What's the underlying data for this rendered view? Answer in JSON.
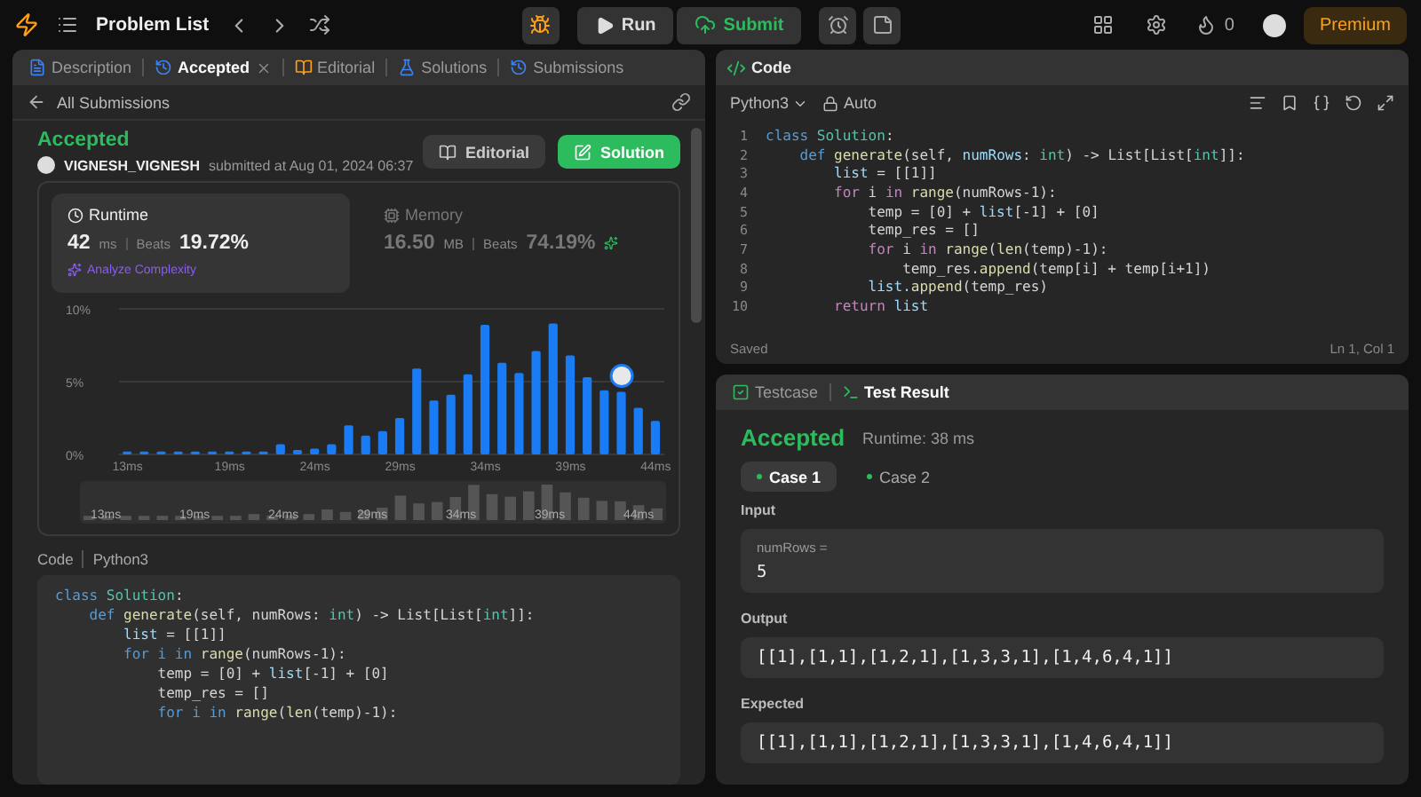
{
  "topbar": {
    "title": "Problem List",
    "run": "Run",
    "submit": "Submit",
    "streak": "0",
    "premium": "Premium"
  },
  "left": {
    "tabs": [
      {
        "label": "Description",
        "selected": false,
        "closable": false
      },
      {
        "label": "Accepted",
        "selected": true,
        "closable": true
      },
      {
        "label": "Editorial",
        "selected": false,
        "closable": false
      },
      {
        "label": "Solutions",
        "selected": false,
        "closable": false
      },
      {
        "label": "Submissions",
        "selected": false,
        "closable": false
      }
    ],
    "back": "All Submissions",
    "status": "Accepted",
    "user": "VIGNESH_VIGNESH",
    "submitted": "submitted at Aug 01, 2024 06:37",
    "buttons": [
      {
        "label": "Editorial",
        "kind": "secondary"
      },
      {
        "label": "Solution",
        "kind": "primary"
      }
    ],
    "metrics": [
      {
        "label": "Runtime",
        "value": "42",
        "unit": "ms",
        "beats_label": "Beats",
        "beats": "19.72%",
        "selected": true,
        "extra": "Analyze Complexity"
      },
      {
        "label": "Memory",
        "value": "16.50",
        "unit": "MB",
        "beats_label": "Beats",
        "beats": "74.19%",
        "selected": false
      }
    ],
    "chart_data": {
      "type": "bar",
      "x": [
        13,
        14,
        15,
        16,
        17,
        18,
        19,
        20,
        21,
        22,
        23,
        24,
        25,
        26,
        27,
        28,
        29,
        30,
        31,
        32,
        33,
        34,
        35,
        36,
        37,
        38,
        39,
        40,
        41,
        42,
        43,
        44
      ],
      "values": [
        0.2,
        0.2,
        0.2,
        0.2,
        0.2,
        0.2,
        0.2,
        0.2,
        0.2,
        0.7,
        0.3,
        0.4,
        0.7,
        2.0,
        1.3,
        1.6,
        2.5,
        5.9,
        3.7,
        4.1,
        5.5,
        8.9,
        6.3,
        5.6,
        7.1,
        9.0,
        6.8,
        5.3,
        4.4,
        4.3,
        3.2,
        2.3
      ],
      "xlim": [
        12.5,
        44.5
      ],
      "xticks": [
        {
          "value": 13,
          "label": "13ms"
        },
        {
          "value": 19,
          "label": "19ms"
        },
        {
          "value": 24,
          "label": "24ms"
        },
        {
          "value": 29,
          "label": "29ms"
        },
        {
          "value": 34,
          "label": "34ms"
        },
        {
          "value": 39,
          "label": "39ms"
        },
        {
          "value": 44,
          "label": "44ms"
        }
      ],
      "yticks": [
        {
          "value": 0,
          "label": "0%"
        },
        {
          "value": 5,
          "label": "5%"
        },
        {
          "value": 10,
          "label": "10%"
        }
      ],
      "ylim": [
        0,
        10
      ]
    },
    "overview_ticks": [
      "13ms",
      "19ms",
      "24ms",
      "29ms",
      "34ms",
      "39ms",
      "44ms"
    ],
    "code_label": "Code",
    "code_lang": "Python3",
    "code": [
      [
        {
          "text": "class",
          "kind": "kw"
        },
        {
          "text": " Solution",
          "kind": "cls"
        },
        {
          "text": ":",
          "kind": "plain"
        }
      ],
      [
        {
          "text": "    def",
          "kind": "kw"
        },
        {
          "text": " generate",
          "kind": "fn"
        },
        {
          "text": "(self, numRows: ",
          "kind": "plain"
        },
        {
          "text": "int",
          "kind": "type"
        },
        {
          "text": ") -> List[List[",
          "kind": "plain"
        },
        {
          "text": "int",
          "kind": "type"
        },
        {
          "text": "]]:",
          "kind": "plain"
        }
      ],
      [
        {
          "text": "        list",
          "kind": "var"
        },
        {
          "text": " = [[1]]",
          "kind": "plain"
        }
      ],
      [
        {
          "text": "        for i in",
          "kind": "kw"
        },
        {
          "text": " range",
          "kind": "fn"
        },
        {
          "text": "(numRows-1):",
          "kind": "plain"
        }
      ],
      [
        {
          "text": "            temp = [0] + ",
          "kind": "plain"
        },
        {
          "text": "list",
          "kind": "var"
        },
        {
          "text": "[-1] + [0]",
          "kind": "plain"
        }
      ],
      [
        {
          "text": "            temp_res = []",
          "kind": "plain"
        }
      ],
      [
        {
          "text": "            for i in",
          "kind": "kw"
        },
        {
          "text": " range",
          "kind": "fn"
        },
        {
          "text": "(",
          "kind": "plain"
        },
        {
          "text": "len",
          "kind": "fn"
        },
        {
          "text": "(temp)-1):",
          "kind": "plain"
        }
      ]
    ]
  },
  "editor": {
    "title": "Code",
    "language": "Python3",
    "mode": "Auto",
    "saved": "Saved",
    "position": "Ln 1, Col 1",
    "lines": [
      {
        "n": "1",
        "tokens": [
          {
            "text": "class",
            "kind": "kw"
          },
          {
            "text": " Solution",
            "kind": "cls"
          },
          {
            "text": ":",
            "kind": "plain"
          }
        ]
      },
      {
        "n": "2",
        "tokens": [
          {
            "text": "    def",
            "kind": "kw"
          },
          {
            "text": " generate",
            "kind": "fn"
          },
          {
            "text": "(self, ",
            "kind": "plain"
          },
          {
            "text": "numRows",
            "kind": "var"
          },
          {
            "text": ": ",
            "kind": "plain"
          },
          {
            "text": "int",
            "kind": "type"
          },
          {
            "text": ") -> List[List[",
            "kind": "plain"
          },
          {
            "text": "int",
            "kind": "type"
          },
          {
            "text": "]]:",
            "kind": "plain"
          }
        ]
      },
      {
        "n": "3",
        "tokens": [
          {
            "text": "        list",
            "kind": "var"
          },
          {
            "text": " = [[1]]",
            "kind": "plain"
          }
        ]
      },
      {
        "n": "4",
        "tokens": [
          {
            "text": "        for",
            "kind": "ctl"
          },
          {
            "text": " i ",
            "kind": "plain"
          },
          {
            "text": "in",
            "kind": "ctl"
          },
          {
            "text": " range",
            "kind": "fn"
          },
          {
            "text": "(numRows-1):",
            "kind": "plain"
          }
        ]
      },
      {
        "n": "5",
        "tokens": [
          {
            "text": "            temp = [0] + ",
            "kind": "plain"
          },
          {
            "text": "list",
            "kind": "var"
          },
          {
            "text": "[-1] + [0]",
            "kind": "plain"
          }
        ]
      },
      {
        "n": "6",
        "tokens": [
          {
            "text": "            temp_res = []",
            "kind": "plain"
          }
        ]
      },
      {
        "n": "7",
        "tokens": [
          {
            "text": "            for",
            "kind": "ctl"
          },
          {
            "text": " i ",
            "kind": "plain"
          },
          {
            "text": "in",
            "kind": "ctl"
          },
          {
            "text": " range",
            "kind": "fn"
          },
          {
            "text": "(",
            "kind": "plain"
          },
          {
            "text": "len",
            "kind": "fn"
          },
          {
            "text": "(temp)-1):",
            "kind": "plain"
          }
        ]
      },
      {
        "n": "8",
        "tokens": [
          {
            "text": "                temp_res.",
            "kind": "plain"
          },
          {
            "text": "append",
            "kind": "fn"
          },
          {
            "text": "(temp[i] + temp[i+1])",
            "kind": "plain"
          }
        ]
      },
      {
        "n": "9",
        "tokens": [
          {
            "text": "            list.",
            "kind": "var"
          },
          {
            "text": "append",
            "kind": "fn"
          },
          {
            "text": "(temp_res)",
            "kind": "plain"
          }
        ]
      },
      {
        "n": "10",
        "tokens": [
          {
            "text": "        return",
            "kind": "ctl"
          },
          {
            "text": " list",
            "kind": "var"
          }
        ]
      }
    ]
  },
  "result": {
    "tabs": [
      {
        "label": "Testcase",
        "selected": false
      },
      {
        "label": "Test Result",
        "selected": true
      }
    ],
    "status": "Accepted",
    "runtime": "Runtime: 38 ms",
    "cases": [
      {
        "label": "Case 1",
        "selected": true
      },
      {
        "label": "Case 2",
        "selected": false
      }
    ],
    "input_label": "Input",
    "input_name": "numRows =",
    "input_value": "5",
    "output_label": "Output",
    "output": "[[1],[1,1],[1,2,1],[1,3,3,1],[1,4,6,4,1]]",
    "expected_label": "Expected",
    "expected": "[[1],[1,1],[1,2,1],[1,3,3,1],[1,4,6,4,1]]"
  }
}
